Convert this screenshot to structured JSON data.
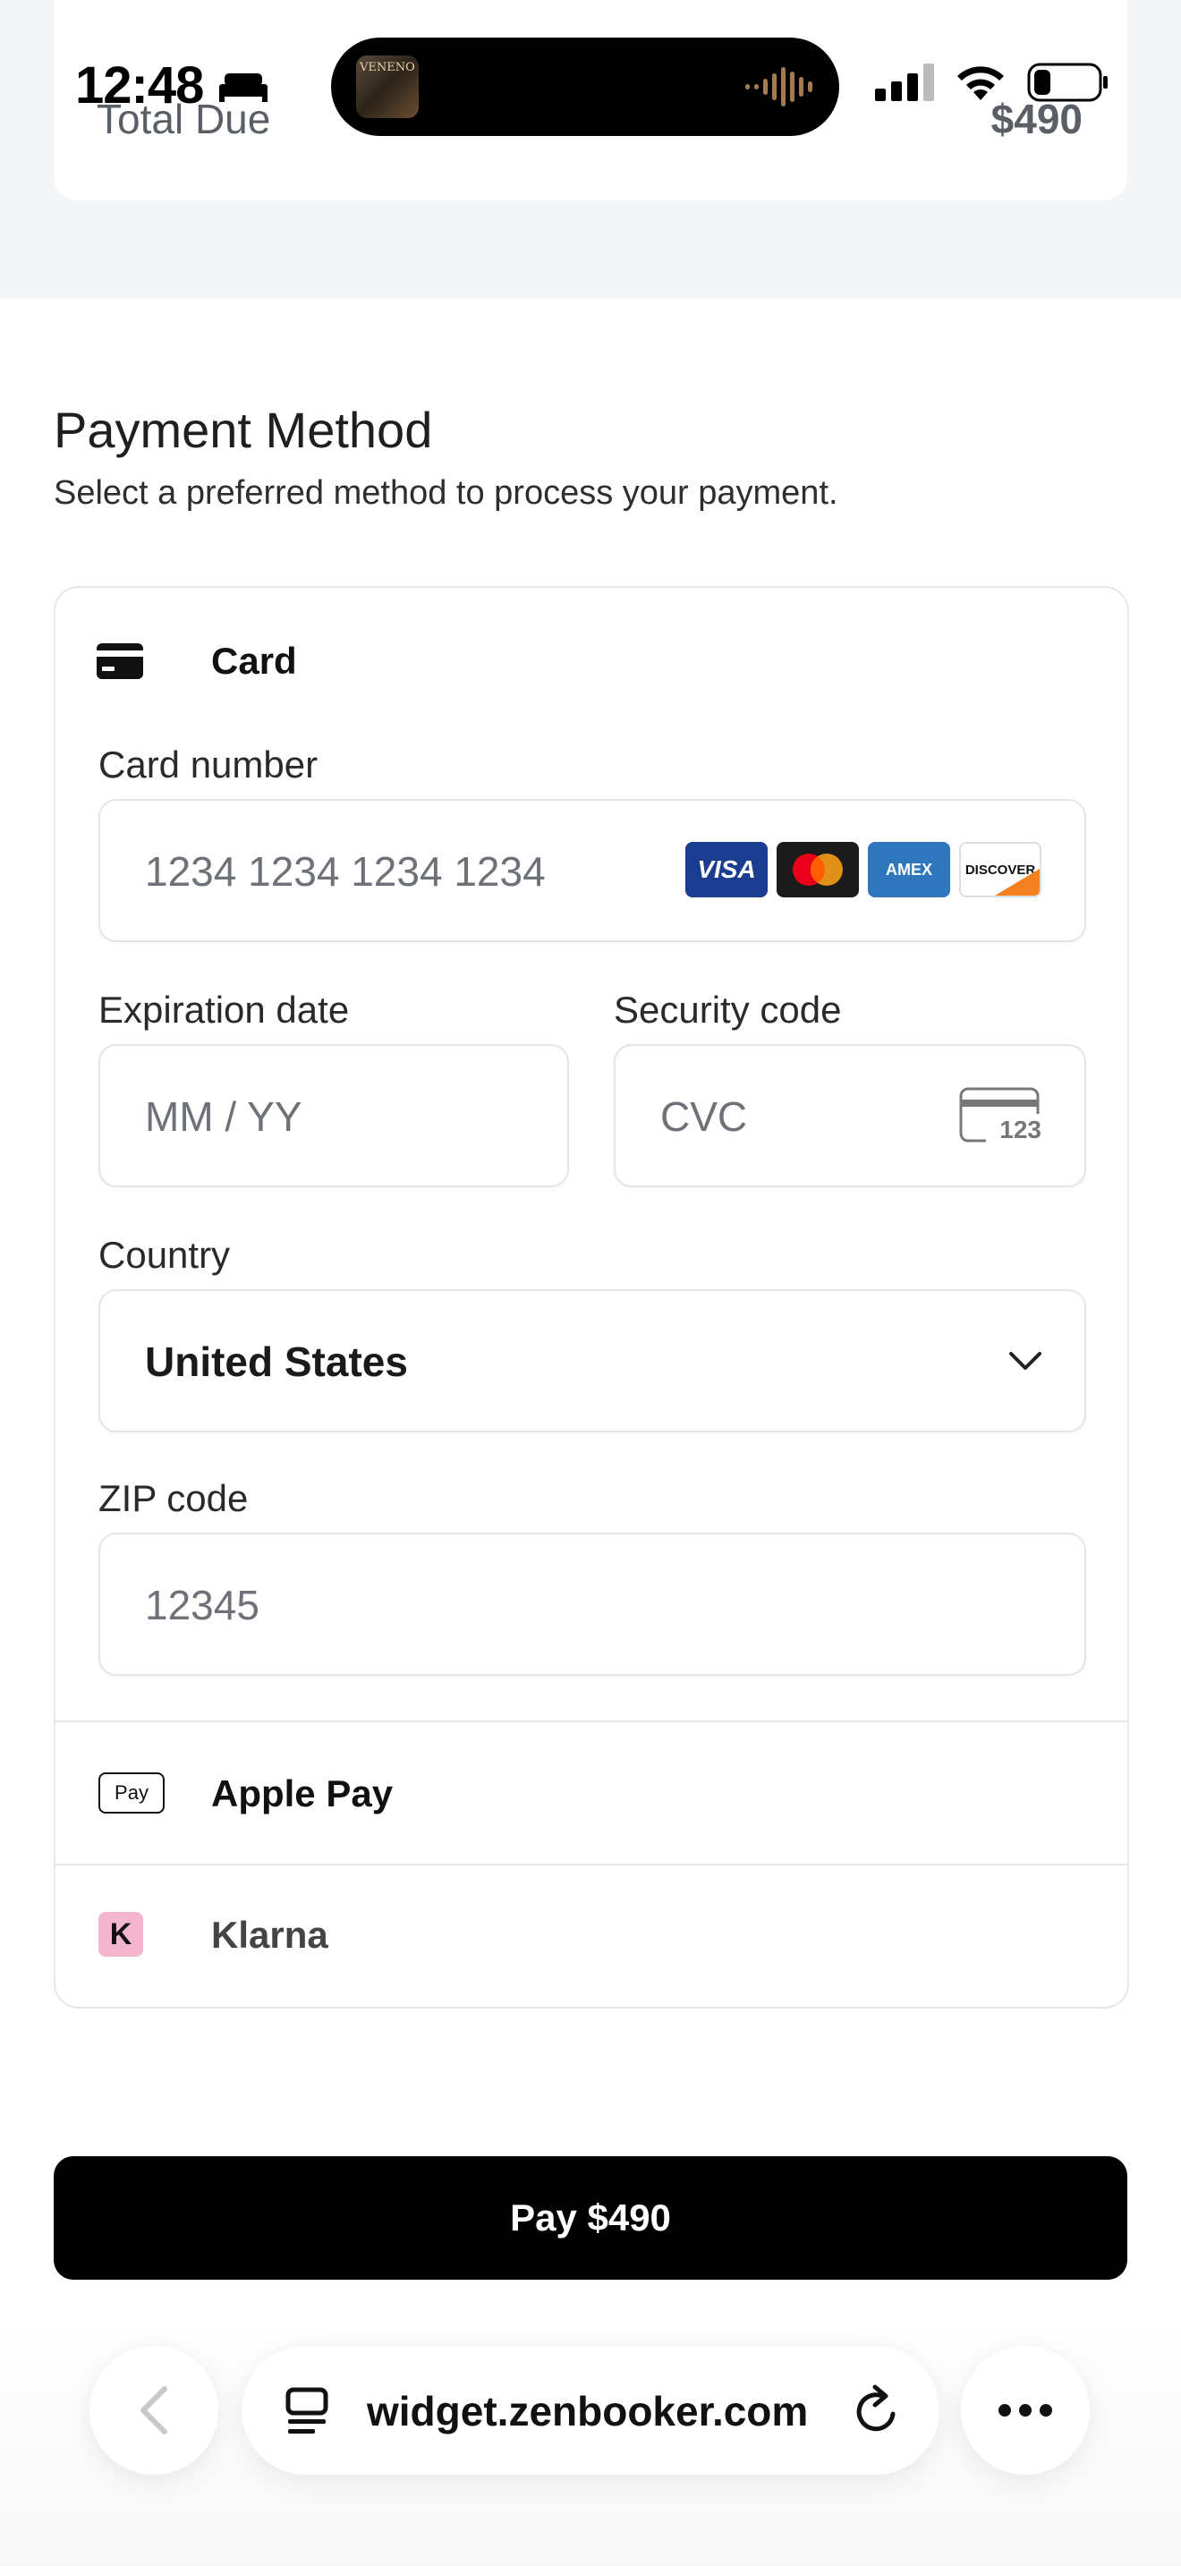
{
  "status_bar": {
    "time": "12:48",
    "album_art_text": "VENENO"
  },
  "summary": {
    "total_label": "Total Due",
    "total_value": "$490"
  },
  "payment": {
    "title": "Payment Method",
    "subtitle": "Select a preferred method to process your payment.",
    "card": {
      "label": "Card",
      "card_number_label": "Card number",
      "card_number_placeholder": "1234 1234 1234 1234",
      "brands": [
        "VISA",
        "AMEX",
        "DISCOVER"
      ],
      "expiration_label": "Expiration date",
      "expiration_placeholder": "MM / YY",
      "security_label": "Security code",
      "security_placeholder": "CVC",
      "cvc_icon_text": "123",
      "country_label": "Country",
      "country_value": "United States",
      "zip_label": "ZIP code",
      "zip_placeholder": "12345"
    },
    "apple_pay": {
      "label": "Apple Pay",
      "badge": "Pay"
    },
    "klarna": {
      "label": "Klarna",
      "badge": "K"
    }
  },
  "pay_button": {
    "label": "Pay $490"
  },
  "browser": {
    "url": "widget.zenbooker.com"
  },
  "colors": {
    "accent": "#000000",
    "klarna_pink": "#f4b5cf",
    "visa_blue": "#1a3d8f",
    "amex_blue": "#2e77bc"
  }
}
